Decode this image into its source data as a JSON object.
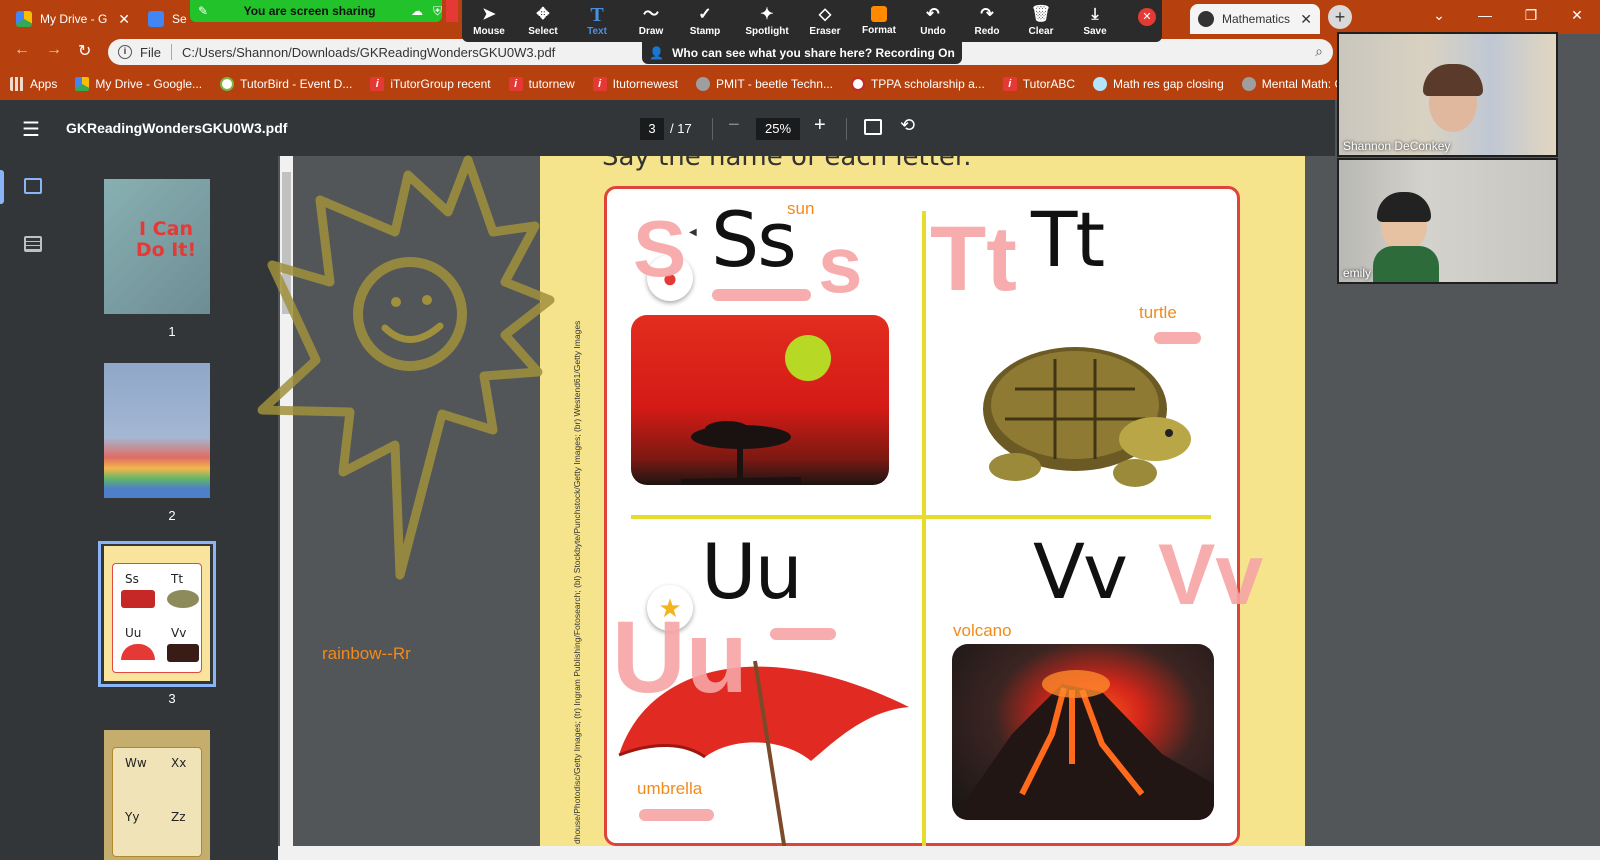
{
  "browser": {
    "tabs": [
      {
        "label": "My Drive - G"
      },
      {
        "label": "Se"
      },
      {
        "label": "Mathematics"
      }
    ],
    "address_scheme": "File",
    "address_url": "C:/Users/Shannon/Downloads/GKReadingWondersGKU0W3.pdf",
    "bookmarks": [
      {
        "label": "Apps",
        "icon": "apps-grid-icon"
      },
      {
        "label": "My Drive - Google...",
        "icon": "google-drive-icon"
      },
      {
        "label": "TutorBird - Event D...",
        "icon": "globe-icon"
      },
      {
        "label": "iTutorGroup recent",
        "icon": "itutor-icon"
      },
      {
        "label": "tutornew",
        "icon": "itutor-icon"
      },
      {
        "label": "Itutornewest",
        "icon": "itutor-icon"
      },
      {
        "label": "PMIT - beetle Techn...",
        "icon": "gray-circle-icon"
      },
      {
        "label": "TPPA scholarship a...",
        "icon": "seal-icon"
      },
      {
        "label": "TutorABC",
        "icon": "itutor-icon"
      },
      {
        "label": "Math res gap closing",
        "icon": "world-icon"
      },
      {
        "label": "Mental Math: G",
        "icon": "gray-circle-icon"
      }
    ]
  },
  "screen_share": {
    "status": "You are screen sharing",
    "recording_notice": "Who can see what you share here? Recording On",
    "tools": [
      {
        "label": "Mouse",
        "icon": "cursor-arrow-icon"
      },
      {
        "label": "Select",
        "icon": "move-arrows-icon"
      },
      {
        "label": "Text",
        "icon": "text-t-icon"
      },
      {
        "label": "Draw",
        "icon": "squiggle-icon"
      },
      {
        "label": "Stamp",
        "icon": "checkmark-icon"
      },
      {
        "label": "Spotlight",
        "icon": "magic-wand-icon"
      },
      {
        "label": "Eraser",
        "icon": "eraser-icon"
      },
      {
        "label": "Format",
        "icon": "color-swatch-icon"
      },
      {
        "label": "Undo",
        "icon": "undo-icon"
      },
      {
        "label": "Redo",
        "icon": "redo-icon"
      },
      {
        "label": "Clear",
        "icon": "trash-icon"
      },
      {
        "label": "Save",
        "icon": "download-icon"
      }
    ],
    "active_tool": "Text",
    "format_color": "#ff8a00"
  },
  "pdf": {
    "title": "GKReadingWondersGKU0W3.pdf",
    "page_current": "3",
    "page_total": "/ 17",
    "zoom": "25%",
    "thumbnails": [
      {
        "number": "1",
        "title": "I Can Do It!"
      },
      {
        "number": "2"
      },
      {
        "number": "3"
      },
      {
        "number": ""
      }
    ],
    "thumb3_letters": [
      "Ss",
      "Tt",
      "Uu",
      "Vv"
    ],
    "thumb4_letters": [
      "Ww",
      "Xx",
      "Yy",
      "Zz"
    ]
  },
  "page": {
    "heading": "Say the name of each letter.",
    "photo_credit": "dhouse/Photodisc/Getty Images; (tr) Ingram Publishing/Fotosearch; (bl) Stockbyte/Punchstock/Getty Images; (br) Westend61/Getty Images",
    "quadrants": [
      {
        "letters": "Ss",
        "word": "sun"
      },
      {
        "letters": "Tt",
        "word": "turtle"
      },
      {
        "letters": "Uu",
        "word": "umbrella"
      },
      {
        "letters": "Vv",
        "word": "volcano"
      }
    ]
  },
  "annotations": {
    "typed_note": "rainbow--Rr",
    "text_color": "#f28a1a",
    "pink_letters": {
      "s_lower": "S",
      "s_small": "s",
      "t_pair": "Tt",
      "u_pair": "Uu",
      "v_pair": "Vv"
    },
    "pink_color": "#f7a5a5",
    "sun_doodle_color": "#9a8a3a"
  },
  "participants": [
    {
      "name": "Shannon DeConkey"
    },
    {
      "name": "emily"
    }
  ]
}
